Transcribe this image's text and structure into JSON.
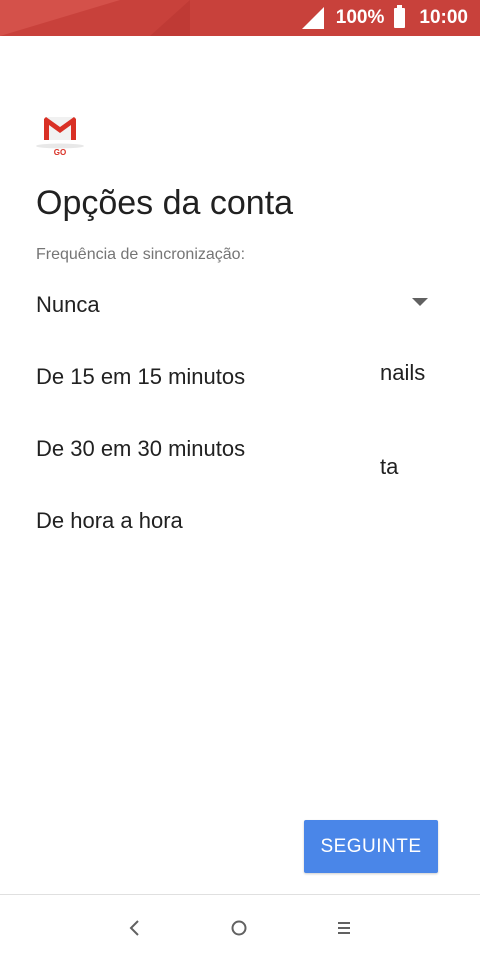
{
  "status_bar": {
    "battery_percent": "100%",
    "time": "10:00",
    "background_color": "#c8413b"
  },
  "logo": {
    "icon": "gmail-go-icon",
    "text": "GO"
  },
  "page": {
    "title": "Opções da conta",
    "sync_label": "Frequência de sincronização:"
  },
  "dropdown": {
    "options": [
      "Nunca",
      "De 15 em 15 minutos",
      "De 30 em 30 minutos",
      "De hora a hora"
    ],
    "arrow_icon": "dropdown-arrow-icon"
  },
  "behind": {
    "fragment_1": "nails",
    "fragment_2": "ta"
  },
  "actions": {
    "next_label": "SEGUINTE",
    "next_color": "#4a86e8"
  },
  "nav": {
    "back_icon": "back-icon",
    "home_icon": "home-icon",
    "menu_icon": "menu-icon"
  }
}
